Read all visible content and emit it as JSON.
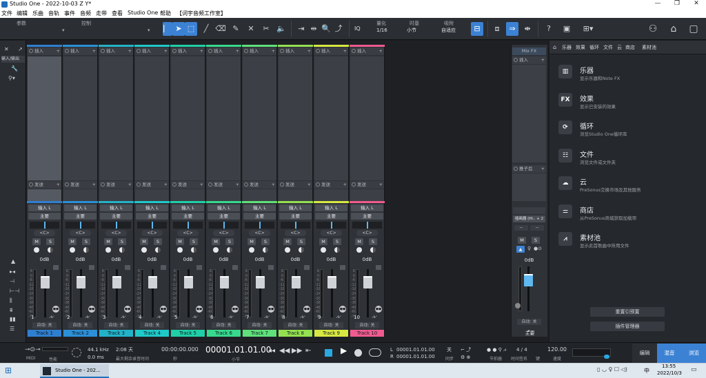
{
  "window": {
    "title": "Studio One - 2022-10-03 Z Y*"
  },
  "menu": [
    "文件",
    "编辑",
    "乐曲",
    "音轨",
    "事件",
    "音频",
    "走带",
    "查看",
    "Studio One",
    "帮助",
    "【词宇音频工作室】"
  ],
  "toolbar": {
    "param_label": "参数",
    "control_label": "控制",
    "quantize": {
      "label": "量化",
      "value": "1/16"
    },
    "timebase": {
      "label": "时基",
      "value": "小节"
    },
    "snap": {
      "label": "吸附",
      "value": "自适应"
    },
    "iq": "IQ"
  },
  "channels": {
    "insert_label": "插入",
    "send_label": "发送",
    "input_label": "输入 L",
    "output_label": "主要",
    "pan": "<C>",
    "mute": "M",
    "solo": "S",
    "volume": "0dB",
    "auto_label": "自动: 关",
    "list": [
      {
        "num": "1",
        "name": "Track 1",
        "color": "#2f7fd0"
      },
      {
        "num": "2",
        "name": "Track 2",
        "color": "#2c8fd8"
      },
      {
        "num": "3",
        "name": "Track 3",
        "color": "#23b3c8"
      },
      {
        "num": "4",
        "name": "Track 4",
        "color": "#1fc9c9"
      },
      {
        "num": "5",
        "name": "Track 5",
        "color": "#20cfa8"
      },
      {
        "num": "6",
        "name": "Track 6",
        "color": "#37d98c"
      },
      {
        "num": "7",
        "name": "Track 7",
        "color": "#5fe07a"
      },
      {
        "num": "8",
        "name": "Track 8",
        "color": "#95e050"
      },
      {
        "num": "9",
        "name": "Track 9",
        "color": "#d8e842"
      },
      {
        "num": "10",
        "name": "Track 10",
        "color": "#ef5b8e"
      }
    ],
    "scale": [
      "6",
      "0",
      "-6",
      "-12",
      "-18",
      "-24",
      "-30",
      "-36",
      "-48",
      "-60",
      "-72"
    ]
  },
  "leftbar": {
    "input_label": "输入/输出"
  },
  "main_channel": {
    "fx_label": "Mix FX",
    "insert_label": "插入",
    "post_label": "推子后",
    "route": "插画器 (Hi.. + 2",
    "mute": "M",
    "solo": "S",
    "volume": "0dB",
    "auto_label": "自动: 关",
    "name": "主要"
  },
  "browser": {
    "tabs": [
      "乐器",
      "效果",
      "循环",
      "文件",
      "云",
      "商店",
      "素材池"
    ],
    "items": [
      {
        "icon": "piano-icon",
        "title": "乐器",
        "subtitle": "显示乐器和Note FX"
      },
      {
        "icon": "fx-icon",
        "title": "效果",
        "subtitle": "显示已安装的效果"
      },
      {
        "icon": "loop-icon",
        "title": "循环",
        "subtitle": "浏览Studio One循环库"
      },
      {
        "icon": "file-icon",
        "title": "文件",
        "subtitle": "浏览文件或文件夹"
      },
      {
        "icon": "cloud-icon",
        "title": "云",
        "subtitle": "PreSonus交换市场及其他服务"
      },
      {
        "icon": "shop-icon",
        "title": "商店",
        "subtitle": "从PreSonus商城获取加载项"
      },
      {
        "icon": "pool-icon",
        "title": "素材池",
        "subtitle": "显示此首歌曲中所用文件"
      }
    ],
    "reset_button": "重置引预置",
    "plugin_manager_button": "插件管理器",
    "fx_icon_text": "FX"
  },
  "transport": {
    "midi_label": "MIDI",
    "performance_label": "性能",
    "sample_rate": "44.1 kHz",
    "latency": "0.0 ms",
    "duration": "2:08 天",
    "max_record": "最大剩余录音时间",
    "seconds_time": "00:00:00.000",
    "seconds_label": "秒",
    "bar_time": "00001.01.01.00",
    "bar_label": "小节",
    "loop_left": "00001.01.01.00",
    "loop_right": "00001.01.01.00",
    "l_label": "L",
    "r_label": "R",
    "sync_label": "同步",
    "metronome_label": "节拍器",
    "off_label": "关",
    "timesig": "4 / 4",
    "timesig_label": "时间签名",
    "key_label": "键",
    "tempo": "120.00",
    "tempo_label": "速度"
  },
  "views": {
    "edit": "编辑",
    "mix": "混音",
    "browse": "浏览"
  },
  "taskbar": {
    "app_label": "Studio One - 202...",
    "time": "13:55",
    "date": "2022/10/3",
    "lang": "中"
  }
}
